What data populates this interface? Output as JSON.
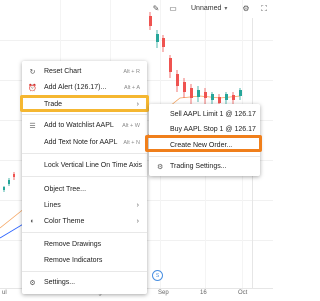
{
  "topbar": {
    "layout_name": "Unnamed",
    "icons": [
      "pencil-icon",
      "layout-icon",
      "settings-icon"
    ]
  },
  "chart": {
    "x_labels": [
      "ul",
      "Aug",
      "Sep",
      "16",
      "Oct"
    ],
    "marker": "S"
  },
  "menu": {
    "reset_chart": {
      "label": "Reset Chart",
      "shortcut": "Alt + R"
    },
    "add_alert": {
      "label": "Add Alert (126.17)...",
      "shortcut": "Alt + A"
    },
    "trade": {
      "label": "Trade"
    },
    "add_watchlist": {
      "label": "Add to Watchlist AAPL",
      "shortcut": "Alt + W"
    },
    "add_text_note": {
      "label": "Add Text Note for AAPL",
      "shortcut": "Alt + N"
    },
    "lock_line": {
      "label": "Lock Vertical Line On Time Axis"
    },
    "object_tree": {
      "label": "Object Tree..."
    },
    "lines": {
      "label": "Lines"
    },
    "color_theme": {
      "label": "Color Theme"
    },
    "remove_drawings": {
      "label": "Remove Drawings"
    },
    "remove_indicators": {
      "label": "Remove Indicators"
    },
    "settings": {
      "label": "Settings..."
    }
  },
  "submenu": {
    "sell": {
      "label": "Sell AAPL Limit 1 @ 126.17"
    },
    "buy": {
      "label": "Buy AAPL Stop 1 @ 126.17"
    },
    "create_order": {
      "label": "Create New Order..."
    },
    "trading_settings": {
      "label": "Trading Settings..."
    }
  },
  "colors": {
    "up_candle": "#26a69a",
    "down_candle": "#ef5350",
    "ma_orange": "#f5a25d",
    "ma_blue": "#2962ff",
    "trade_highlight": "#f5b731",
    "order_highlight": "#f07f1b"
  }
}
